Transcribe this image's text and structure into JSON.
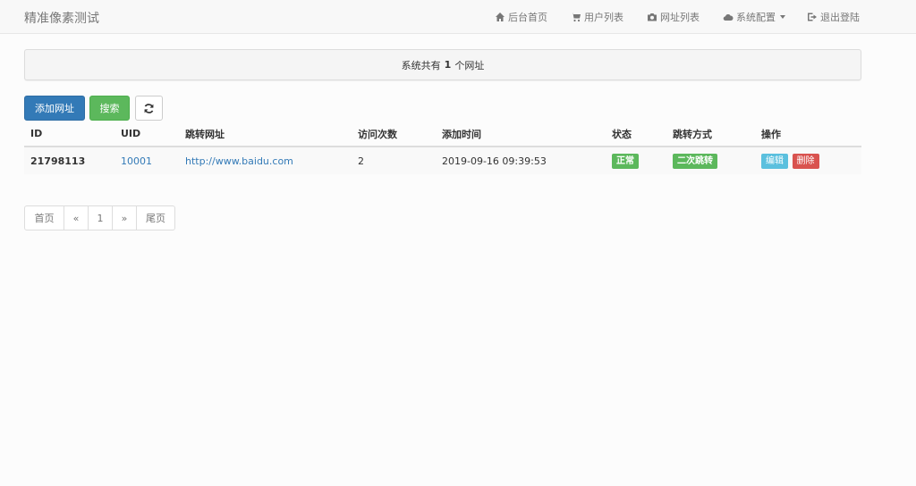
{
  "brand": "精准像素测试",
  "nav": {
    "home": "后台首页",
    "users": "用户列表",
    "urls": "网址列表",
    "config": "系统配置",
    "logout": "退出登陆"
  },
  "summary": {
    "prefix": "系统共有",
    "count": "1",
    "suffix": "个网址"
  },
  "toolbar": {
    "add_label": "添加网址",
    "search_label": "搜索"
  },
  "table": {
    "headers": [
      "ID",
      "UID",
      "跳转网址",
      "访问次数",
      "添加时间",
      "状态",
      "跳转方式",
      "操作"
    ],
    "rows": [
      {
        "id": "21798113",
        "uid": "10001",
        "url": "http://www.baidu.com",
        "visits": "2",
        "added": "2019-09-16 09:39:53",
        "status": "正常",
        "mode": "二次跳转",
        "edit": "编辑",
        "delete": "删除"
      }
    ]
  },
  "pagination": {
    "first": "首页",
    "prev": "«",
    "page": "1",
    "next": "»",
    "last": "尾页"
  },
  "colors": {
    "primary": "#337ab7",
    "success": "#5cb85c",
    "info": "#5bc0de",
    "danger": "#d9534f"
  }
}
